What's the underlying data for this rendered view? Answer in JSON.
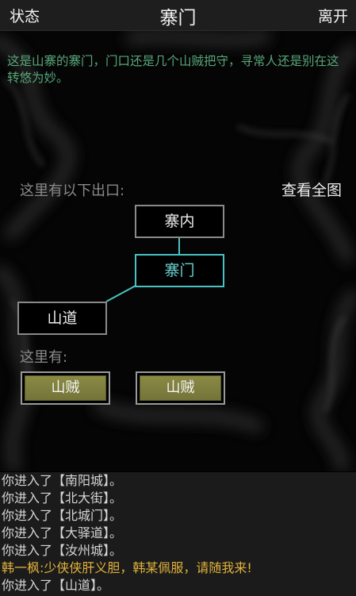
{
  "header": {
    "status_label": "状态",
    "title": "寨门",
    "leave_label": "离开"
  },
  "room": {
    "description": "这是山寨的寨门，门口还是几个山贼把守，寻常人还是别在这转悠为妙。"
  },
  "exits": {
    "label": "这里有以下出口:",
    "full_map_label": "查看全图",
    "north": "寨内",
    "current": "寨门",
    "southwest": "山道"
  },
  "here": {
    "label": "这里有:",
    "npcs": [
      "山贼",
      "山贼"
    ]
  },
  "log": {
    "lines": [
      "你进入了【南阳城】。",
      "你进入了【北大街】。",
      "你进入了【北城门】。",
      "你进入了【大驿道】。",
      "你进入了【汝州城】。",
      "韩一枫:少侠侠肝义胆，韩某佩服，请随我来!",
      "你进入了【山道】。"
    ]
  },
  "colors": {
    "description_text": "#58a77a",
    "current_room_border": "#4bc2c2",
    "npc_button_fill": "#7f7f40",
    "speech_text": "#e2b23c"
  }
}
